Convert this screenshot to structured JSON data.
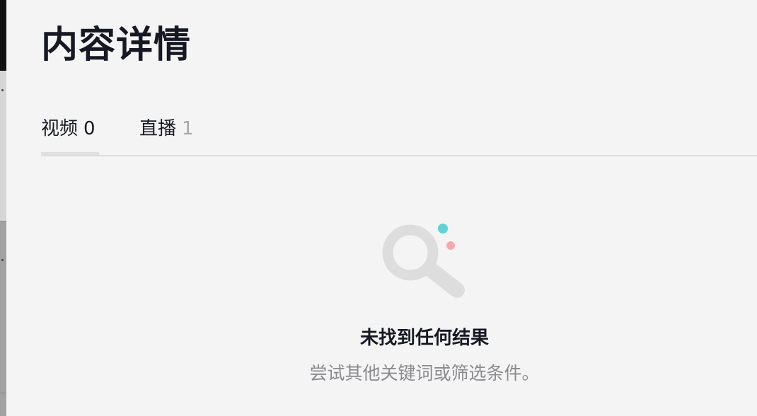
{
  "page": {
    "title": "内容详情"
  },
  "tabs": [
    {
      "label": "视频",
      "count": "0",
      "active": true
    },
    {
      "label": "直播",
      "count": "1",
      "active": false
    }
  ],
  "empty_state": {
    "icon": "search-empty-icon",
    "title": "未找到任何结果",
    "subtitle": "尝试其他关键词或筛选条件。"
  },
  "colors": {
    "background": "#f4f4f4",
    "text_primary": "#161823",
    "text_secondary": "#8a8a8f",
    "count_muted": "#a8a8a8",
    "icon_gray": "#dddddd",
    "dot_cyan": "#5fd3d6",
    "dot_pink": "#f5a9ae"
  }
}
